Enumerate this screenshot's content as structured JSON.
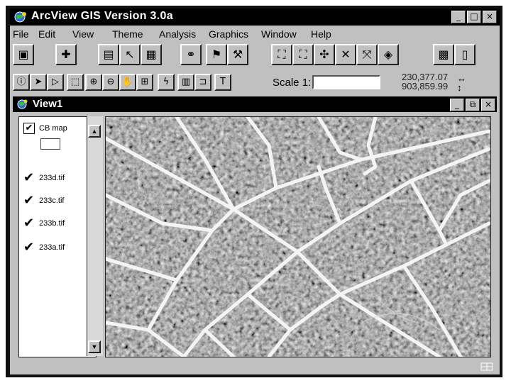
{
  "app": {
    "title": "ArcView GIS Version 3.0a",
    "window_buttons": [
      "_",
      "□",
      "×"
    ]
  },
  "menu": {
    "items": [
      "File",
      "Edit",
      "View",
      "Theme",
      "Analysis",
      "Graphics",
      "Window",
      "Help"
    ],
    "mnemonics": [
      "F",
      "E",
      "V",
      "T",
      "A",
      "G",
      "W",
      "H"
    ]
  },
  "toolbar1": {
    "icons": [
      "save-icon",
      "add-theme-icon",
      "theme-properties-icon",
      "edit-legend-icon",
      "open-table-icon",
      "find-icon",
      "locate-address-icon",
      "hotlink-icon",
      "zoom-full-extent-icon",
      "zoom-active-themes-icon",
      "zoom-selected-icon",
      "zoom-in-fixed-icon",
      "zoom-out-fixed-icon",
      "zoom-previous-icon",
      "layout-icon",
      "help-icon"
    ]
  },
  "toolbar2": {
    "icons": [
      "identify-tool",
      "pointer-tool",
      "vertex-edit-tool",
      "select-feature-tool",
      "zoom-in-tool",
      "zoom-out-tool",
      "pan-tool",
      "measure-tool",
      "hotlink-tool",
      "area-of-interest-tool",
      "label-tool",
      "text-tool"
    ],
    "scale_label": "Scale 1:",
    "scale_value": "",
    "coord_x": "230,377.07",
    "coord_y": "903,859.99",
    "coord_x_arrow": "↔",
    "coord_y_arrow": "↕"
  },
  "view": {
    "title": "View1",
    "window_buttons": [
      "_",
      "⧉",
      "×"
    ]
  },
  "toc": {
    "layers": [
      {
        "name": "CB map",
        "checked": true
      },
      {
        "name": "233d.tif",
        "checked": true
      },
      {
        "name": "233c.tif",
        "checked": true
      },
      {
        "name": "233b.tif",
        "checked": true
      },
      {
        "name": "233a.tif",
        "checked": true
      }
    ],
    "check_glyph": "✔"
  },
  "colors": {
    "titlebar": "#000000",
    "chrome": "#c0c0c0",
    "map_background": "#3a3a3a",
    "road": "#f4f4f4"
  }
}
